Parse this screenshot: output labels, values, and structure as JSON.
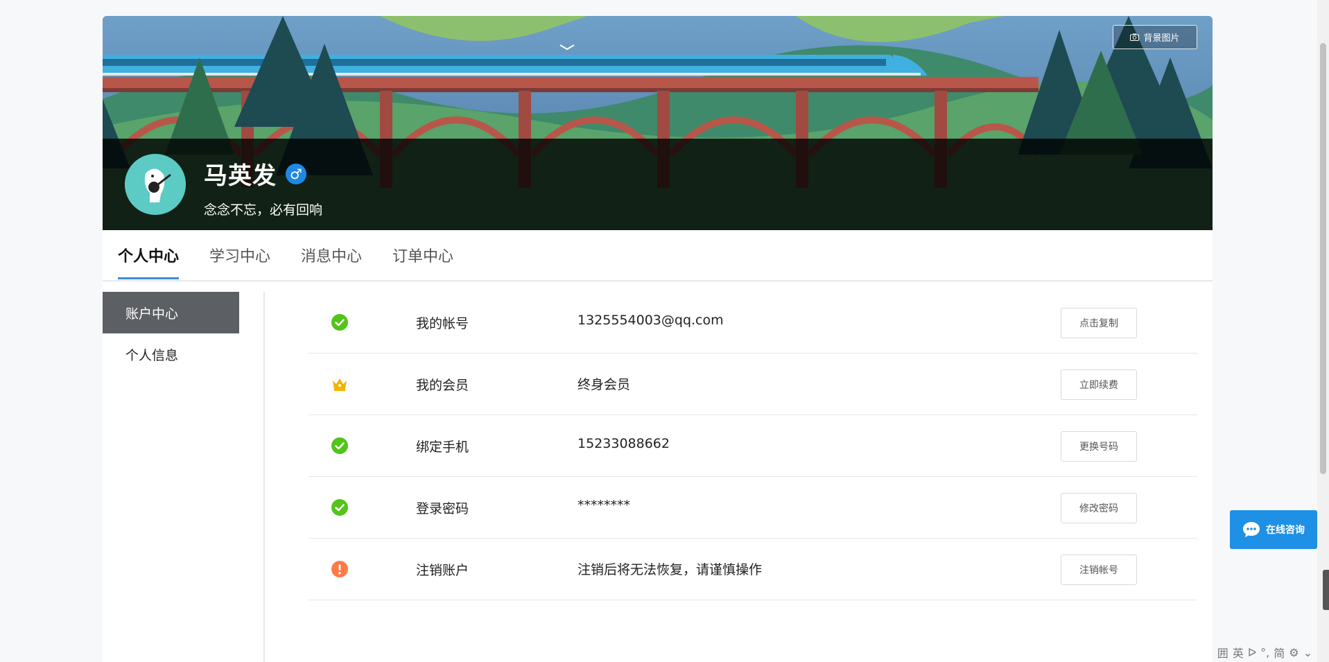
{
  "header": {
    "background_button_label": "背景图片",
    "background_button_icon": "camera-icon"
  },
  "profile": {
    "name": "马英发",
    "gender": "male",
    "gender_symbol": "♂",
    "motto": "念念不忘，必有回响"
  },
  "tabs": [
    {
      "label": "个人中心",
      "active": true
    },
    {
      "label": "学习中心",
      "active": false
    },
    {
      "label": "消息中心",
      "active": false
    },
    {
      "label": "订单中心",
      "active": false
    }
  ],
  "sidebar": {
    "items": [
      {
        "label": "账户中心",
        "active": true
      },
      {
        "label": "个人信息",
        "active": false
      }
    ]
  },
  "account_rows": [
    {
      "icon": "check-circle-icon",
      "label": "我的帐号",
      "value": "1325554003@qq.com",
      "button": "点击复制"
    },
    {
      "icon": "crown-icon",
      "label": "我的会员",
      "value": "终身会员",
      "button": "立即续费"
    },
    {
      "icon": "check-circle-icon",
      "label": "绑定手机",
      "value": "15233088662",
      "button": "更换号码"
    },
    {
      "icon": "check-circle-icon",
      "label": "登录密码",
      "value": "********",
      "button": "修改密码"
    },
    {
      "icon": "warning-circle-icon",
      "label": "注销账户",
      "value": "注销后将无法恢复，请谨慎操作",
      "button": "注销帐号"
    }
  ],
  "chat_widget": {
    "label": "在线咨询"
  },
  "ime_toolbar": {
    "items": [
      "囲",
      "英",
      "ᐅ",
      "°,",
      "简",
      "⚙",
      "⌄"
    ]
  },
  "colors": {
    "accent": "#3b8dd8",
    "success": "#52c41a",
    "warning": "#ff7a45",
    "crown": "#f5b301",
    "chat": "#1e90e6",
    "sidebar_active": "#5c5f63"
  }
}
